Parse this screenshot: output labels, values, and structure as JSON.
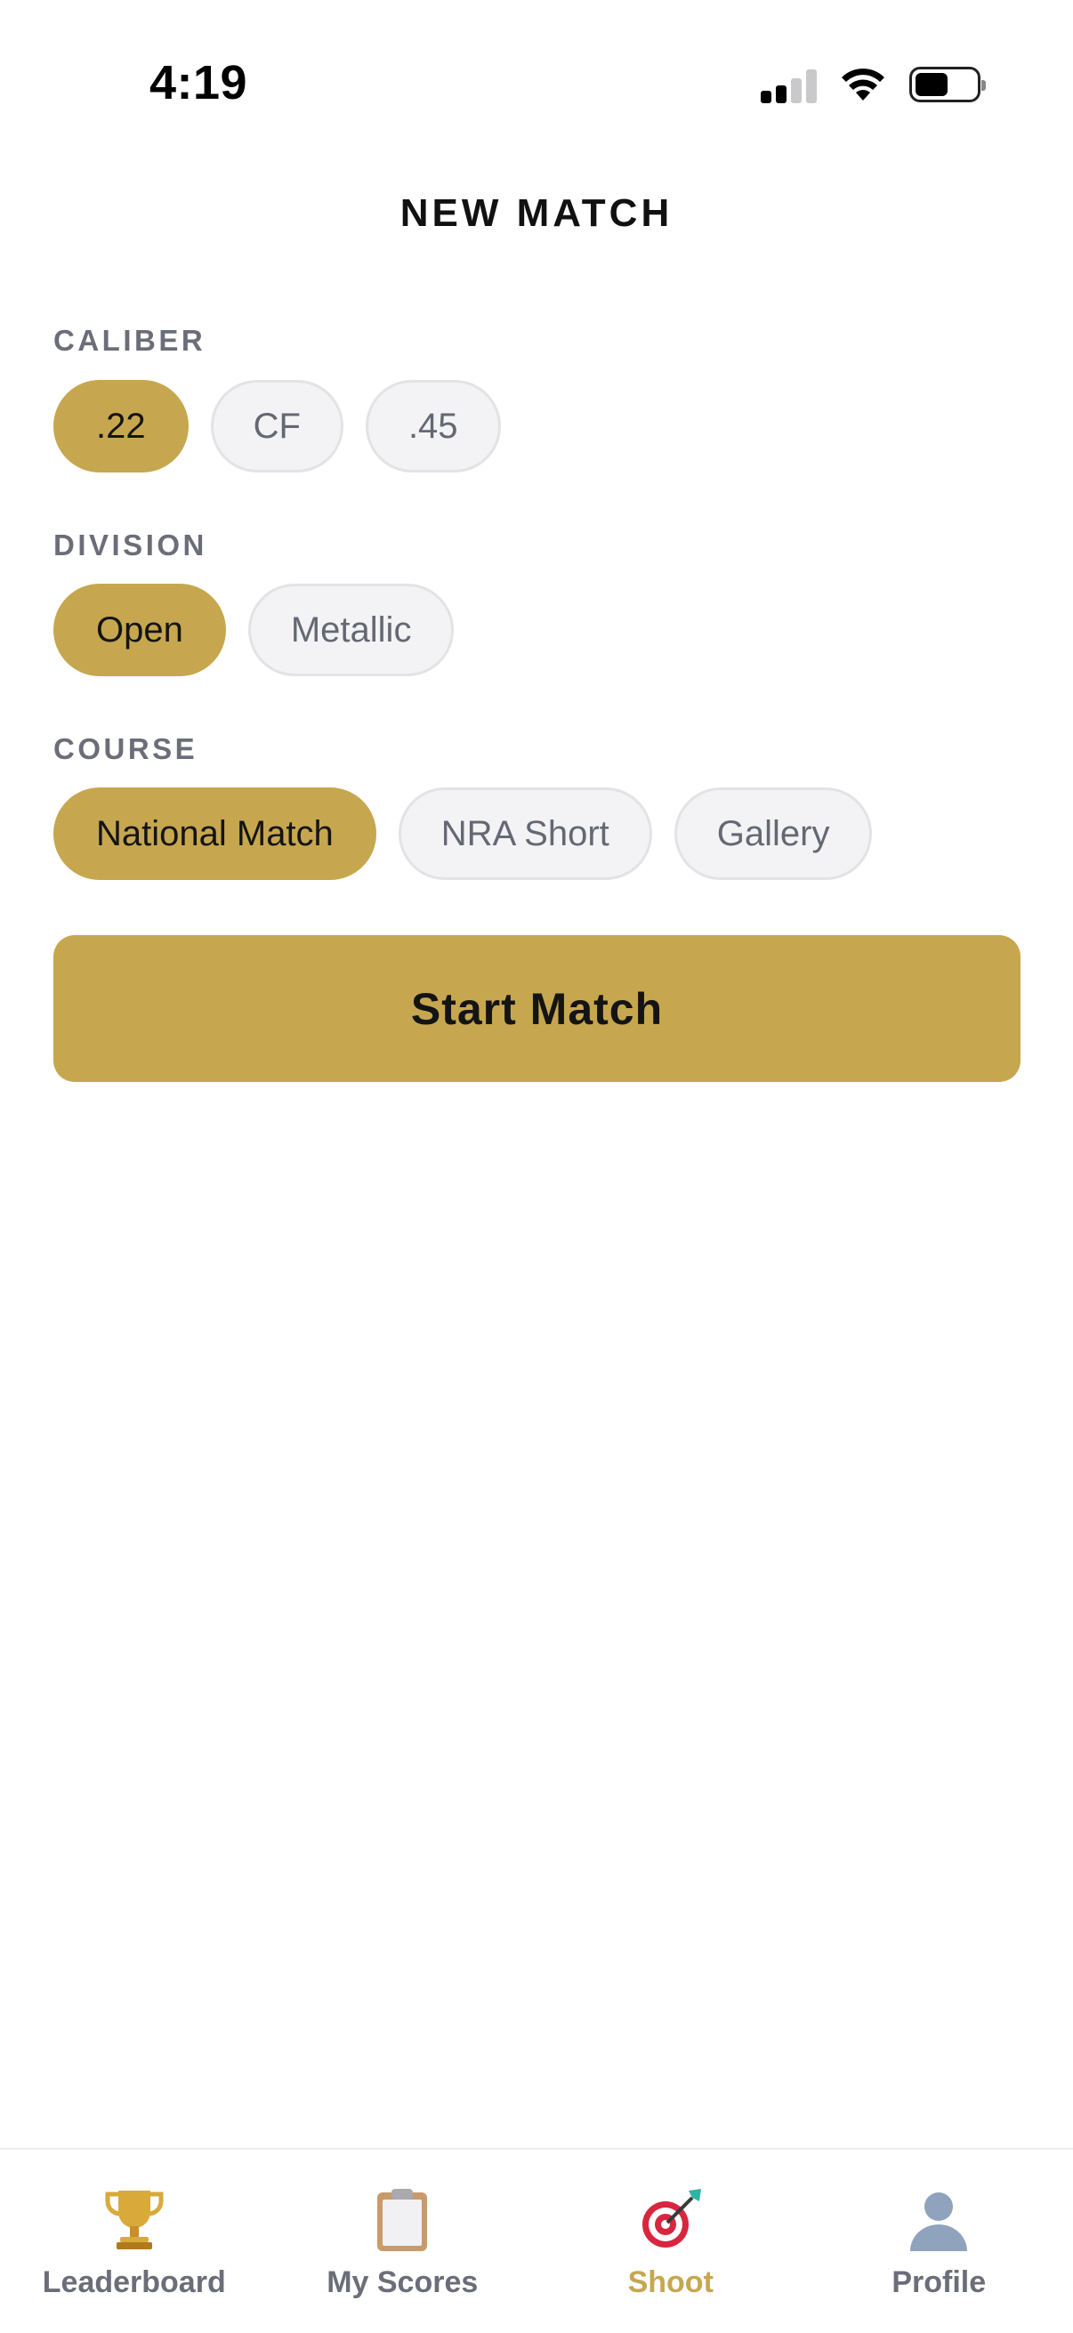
{
  "status_bar": {
    "time": "4:19",
    "signal_icon": "cellular-signal-icon",
    "wifi_icon": "wifi-icon",
    "battery_icon": "battery-icon"
  },
  "header": {
    "title": "NEW MATCH"
  },
  "caliber": {
    "label": "CALIBER",
    "options": [
      ".22",
      "CF",
      ".45"
    ],
    "selected": ".22"
  },
  "division": {
    "label": "DIVISION",
    "options": [
      "Open",
      "Metallic"
    ],
    "selected": "Open"
  },
  "course": {
    "label": "COURSE",
    "options": [
      "National Match",
      "NRA Short",
      "Gallery"
    ],
    "selected": "National Match"
  },
  "actions": {
    "start_label": "Start Match"
  },
  "tab_bar": {
    "tabs": [
      {
        "label": "Leaderboard",
        "icon": "trophy-icon"
      },
      {
        "label": "My Scores",
        "icon": "clipboard-icon"
      },
      {
        "label": "Shoot",
        "icon": "target-icon"
      },
      {
        "label": "Profile",
        "icon": "person-icon"
      }
    ],
    "active": "Shoot"
  },
  "colors": {
    "accent": "#c6a74f",
    "pill_inactive_bg": "#f3f3f5",
    "pill_inactive_text": "#646873",
    "section_label": "#6b6e78"
  }
}
